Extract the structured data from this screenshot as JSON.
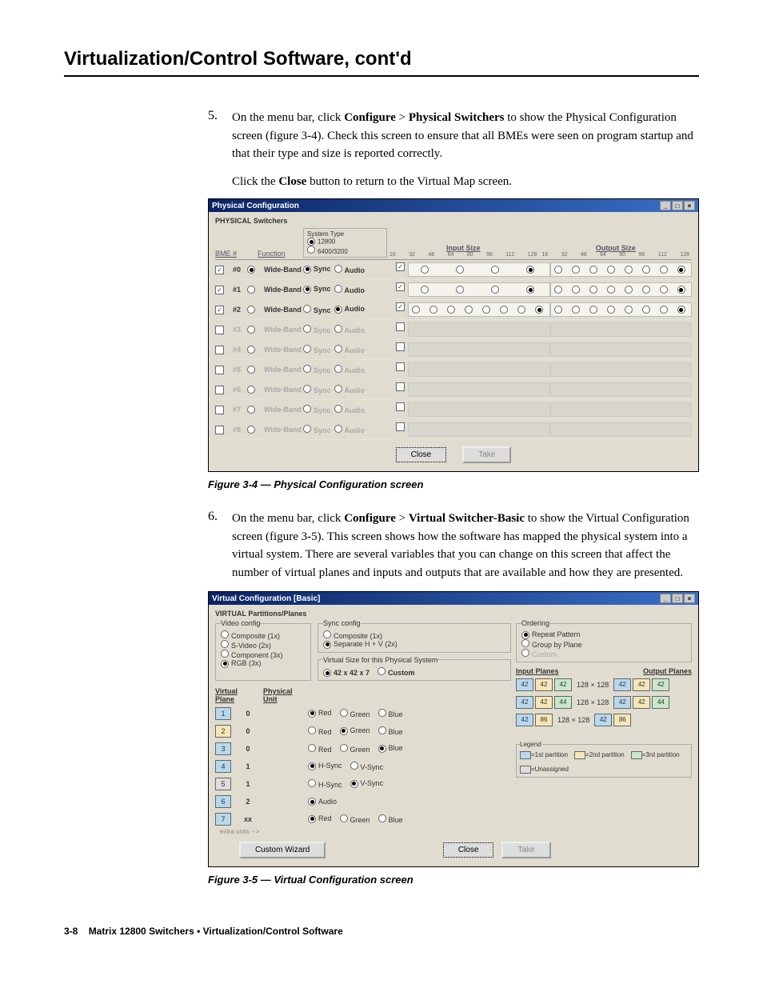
{
  "page": {
    "title": "Virtualization/Control Software, cont'd",
    "footer_pagenum": "3-8",
    "footer_text": "Matrix 12800 Switchers • Virtualization/Control Software"
  },
  "step5": {
    "num": "5.",
    "text_before": "On the menu bar, click ",
    "b1": "Configure",
    "gt": " > ",
    "b2": "Physical Switchers",
    "text_after": " to show the Physical Configuration screen (figure 3-4).  Check this screen to ensure that all BMEs were seen on program startup and that their type and size is reported correctly."
  },
  "para_close": {
    "pre": "Click the ",
    "b": "Close",
    "post": " button to return to the Virtual Map screen."
  },
  "fig34": "Figure 3-4 — Physical Configuration screen",
  "step6": {
    "num": "6.",
    "text_before": "On the menu bar, click ",
    "b1": "Configure",
    "gt": " > ",
    "b2": "Virtual Switcher-Basic",
    "text_after": " to show the Virtual Configuration screen (figure 3-5).  This screen shows how the software has mapped the physical system into a virtual system.  There are several variables that you can change on this screen that affect the number of virtual planes and inputs and outputs that are available and how they are presented."
  },
  "fig35": "Figure 3-5 — Virtual Configuration screen",
  "dlg1": {
    "title": "Physical Configuration",
    "section": "PHYSICAL Switchers",
    "hdr_bme": "BME #",
    "hdr_func": "Function",
    "systype_label": "System Type",
    "systype_opt1": "12800",
    "systype_opt2": "6400/3200",
    "hdr_input": "Input Size",
    "hdr_output": "Output Size",
    "ticks": [
      "16",
      "32",
      "48",
      "64",
      "80",
      "96",
      "112",
      "128"
    ],
    "func_sync": "Sync",
    "func_audio": "Audio",
    "wideband": "Wide-Band",
    "rows": [
      {
        "n": "#0",
        "en": true,
        "wb": true,
        "sync": true,
        "audio": false,
        "in": [
          false,
          false,
          false,
          true
        ],
        "out": [
          false,
          false,
          false,
          false,
          false,
          false,
          false,
          true
        ],
        "sizegrey": false
      },
      {
        "n": "#1",
        "en": true,
        "wb": false,
        "sync": true,
        "audio": false,
        "in": [
          false,
          false,
          false,
          true
        ],
        "out": [
          false,
          false,
          false,
          false,
          false,
          false,
          false,
          true
        ],
        "sizegrey": false
      },
      {
        "n": "#2",
        "en": true,
        "wb": false,
        "sync": false,
        "audio": true,
        "in": [
          false,
          false,
          false,
          false,
          false,
          false,
          false,
          true
        ],
        "out": [
          false,
          false,
          false,
          false,
          false,
          false,
          false,
          true
        ],
        "sizegrey": false
      },
      {
        "n": "#3",
        "en": false,
        "wb": false
      },
      {
        "n": "#4",
        "en": false,
        "wb": false
      },
      {
        "n": "#5",
        "en": false,
        "wb": false
      },
      {
        "n": "#6",
        "en": false,
        "wb": false
      },
      {
        "n": "#7",
        "en": false,
        "wb": false
      },
      {
        "n": "#8",
        "en": false,
        "wb": false
      }
    ],
    "btn_close": "Close",
    "btn_take": "Take"
  },
  "dlg2": {
    "title": "Virtual Configuration [Basic]",
    "section": "VIRTUAL Partitions/Planes",
    "video_cfg_label": "Video config",
    "video_opts": [
      "Composite (1x)",
      "S-Video (2x)",
      "Component (3x)",
      "RGB (3x)"
    ],
    "sync_cfg_label": "Sync config",
    "sync_opts": [
      "Composite (1x)",
      "Separate H + V (2x)"
    ],
    "vsize_label": "Virtual Size for this Physical System",
    "vsize_opt1": "42 x 42 x 7",
    "vsize_opt2": "Custom",
    "ordering_label": "Ordering",
    "ordering_opts": [
      "Repeat Pattern",
      "Group by Plane",
      "Custom"
    ],
    "col_vplane": "Virtual Plane",
    "col_punit": "Physical Unit",
    "rgb": {
      "r": "Red",
      "g": "Green",
      "b": "Blue"
    },
    "hv": {
      "h": "H-Sync",
      "v": "V-Sync"
    },
    "audio": "Audio",
    "extra_label": "extra units -->",
    "extra_val": "xx",
    "planes": [
      {
        "vp": "1",
        "pu": "0",
        "type": "rgb",
        "sel": "r",
        "part": 1
      },
      {
        "vp": "2",
        "pu": "0",
        "type": "rgb",
        "sel": "g",
        "part": 2
      },
      {
        "vp": "3",
        "pu": "0",
        "type": "rgb",
        "sel": "b",
        "part": 1
      },
      {
        "vp": "4",
        "pu": "1",
        "type": "hv",
        "sel": "h",
        "part": 1
      },
      {
        "vp": "5",
        "pu": "1",
        "type": "hv",
        "sel": "v",
        "part": 4
      },
      {
        "vp": "6",
        "pu": "2",
        "type": "audio",
        "sel": "a",
        "part": 1
      },
      {
        "vp": "7",
        "pu": "xx",
        "type": "rgb",
        "sel": "r",
        "part": 1
      }
    ],
    "io_hdr_in": "Input Planes",
    "io_hdr_out": "Output Planes",
    "io_dim": "128 × 128",
    "io_rows": [
      {
        "in": [
          "42",
          "42",
          "42"
        ],
        "out": [
          "42",
          "42",
          "42"
        ]
      },
      {
        "in": [
          "42",
          "42",
          "44"
        ],
        "out": [
          "42",
          "42",
          "44"
        ]
      },
      {
        "in": [
          "42",
          "86"
        ],
        "out": [
          "42",
          "86"
        ]
      }
    ],
    "legend_label": "Legend",
    "legend_items": [
      "=1st partition",
      "=2nd partition",
      "=3rd partition",
      "=Unassigned"
    ],
    "btn_custom": "Custom Wizard",
    "btn_close": "Close",
    "btn_take": "Take"
  }
}
